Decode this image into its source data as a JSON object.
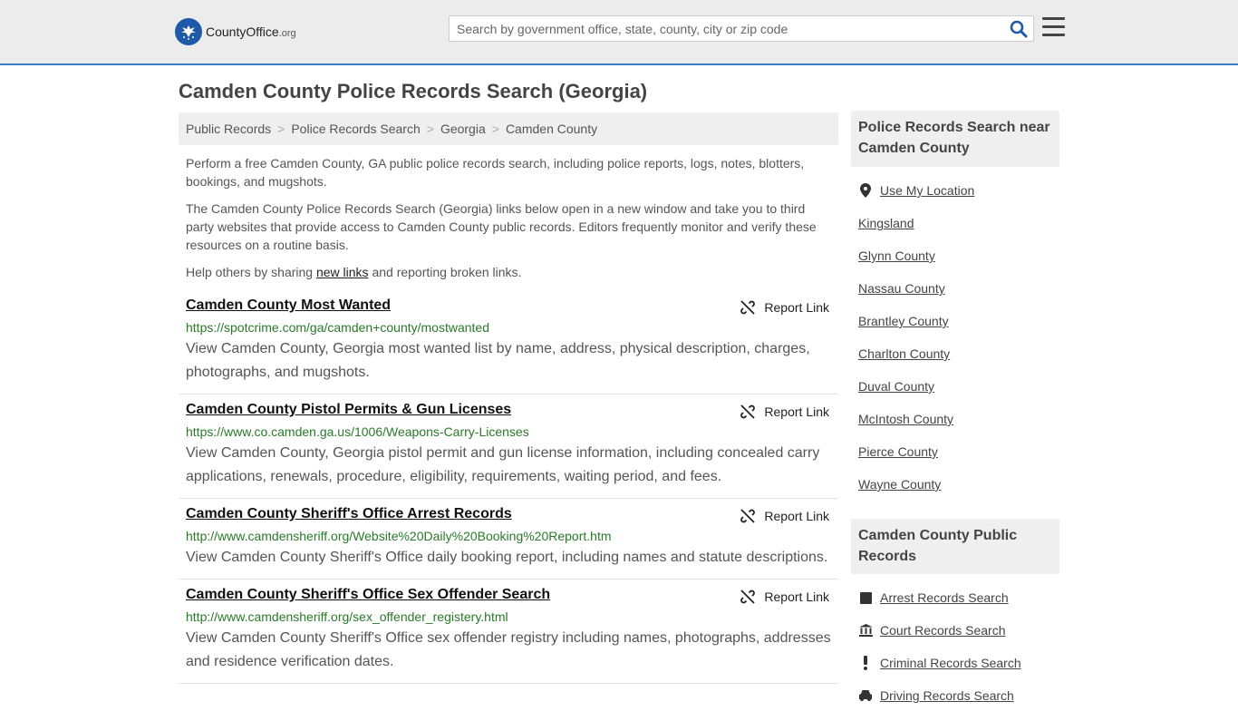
{
  "header": {
    "logo": {
      "name": "CountyOffice",
      "tld": ".org"
    },
    "search_placeholder": "Search by government office, state, county, city or zip code"
  },
  "page": {
    "title": "Camden County Police Records Search (Georgia)"
  },
  "breadcrumb": [
    "Public Records",
    "Police Records Search",
    "Georgia",
    "Camden County"
  ],
  "intro": {
    "p1": "Perform a free Camden County, GA public police records search, including police reports, logs, notes, blotters, bookings, and mugshots.",
    "p2": "The Camden County Police Records Search (Georgia) links below open in a new window and take you to third party websites that provide access to Camden County public records. Editors frequently monitor and verify these resources on a routine basis.",
    "p3_before": "Help others by sharing ",
    "p3_link": "new links",
    "p3_after": " and reporting broken links."
  },
  "report_label": "Report Link",
  "results": [
    {
      "title": "Camden County Most Wanted",
      "url": "https://spotcrime.com/ga/camden+county/mostwanted",
      "desc": "View Camden County, Georgia most wanted list by name, address, physical description, charges, photographs, and mugshots."
    },
    {
      "title": "Camden County Pistol Permits & Gun Licenses",
      "url": "https://www.co.camden.ga.us/1006/Weapons-Carry-Licenses",
      "desc": "View Camden County, Georgia pistol permit and gun license information, including concealed carry applications, renewals, procedure, eligibility, requirements, waiting period, and fees."
    },
    {
      "title": "Camden County Sheriff's Office Arrest Records",
      "url": "http://www.camdensheriff.org/Website%20Daily%20Booking%20Report.htm",
      "desc": "View Camden County Sheriff's Office daily booking report, including names and statute descriptions."
    },
    {
      "title": "Camden County Sheriff's Office Sex Offender Search",
      "url": "http://www.camdensheriff.org/sex_offender_registery.html",
      "desc": "View Camden County Sheriff's Office sex offender registry including names, photographs, addresses and residence verification dates."
    }
  ],
  "sidebar": {
    "nearby_title": "Police Records Search near Camden County",
    "use_location": "Use My Location",
    "nearby": [
      "Kingsland",
      "Glynn County",
      "Nassau County",
      "Brantley County",
      "Charlton County",
      "Duval County",
      "McIntosh County",
      "Pierce County",
      "Wayne County"
    ],
    "public_title": "Camden County Public Records",
    "public_records": [
      {
        "label": "Arrest Records Search",
        "icon": "square-icon"
      },
      {
        "label": "Court Records Search",
        "icon": "courthouse-icon"
      },
      {
        "label": "Criminal Records Search",
        "icon": "exclamation-icon"
      },
      {
        "label": "Driving Records Search",
        "icon": "car-icon"
      }
    ]
  }
}
